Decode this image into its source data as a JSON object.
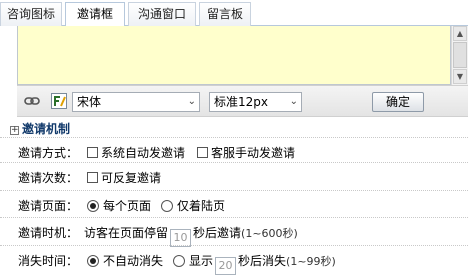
{
  "tabs": [
    {
      "label": "咨询图标",
      "active": false
    },
    {
      "label": "邀请框",
      "active": true
    },
    {
      "label": "沟通窗口",
      "active": false
    },
    {
      "label": "留言板",
      "active": false
    }
  ],
  "editor": {
    "background": "#ffffcc"
  },
  "toolbar": {
    "font_select": "宋体",
    "size_select": "标准12px",
    "confirm_label": "确定"
  },
  "section": {
    "title": "邀请机制"
  },
  "rows": {
    "method": {
      "label": "邀请方式：",
      "opt1": "系统自动发邀请",
      "opt2": "客服手动发邀请"
    },
    "times": {
      "label": "邀请次数：",
      "opt1": "可反复邀请"
    },
    "page": {
      "label": "邀请页面：",
      "opt1": "每个页面",
      "opt2": "仅着陆页"
    },
    "timing": {
      "label": "邀请时机：",
      "pre": "访客在页面停留",
      "value": "10",
      "post": "秒后邀请",
      "range": "(1~600秒)"
    },
    "disappear": {
      "label": "消失时间：",
      "opt1": "不自动消失",
      "opt2": "显示",
      "value": "20",
      "post": "秒后消失",
      "range": "(1~99秒)"
    }
  }
}
